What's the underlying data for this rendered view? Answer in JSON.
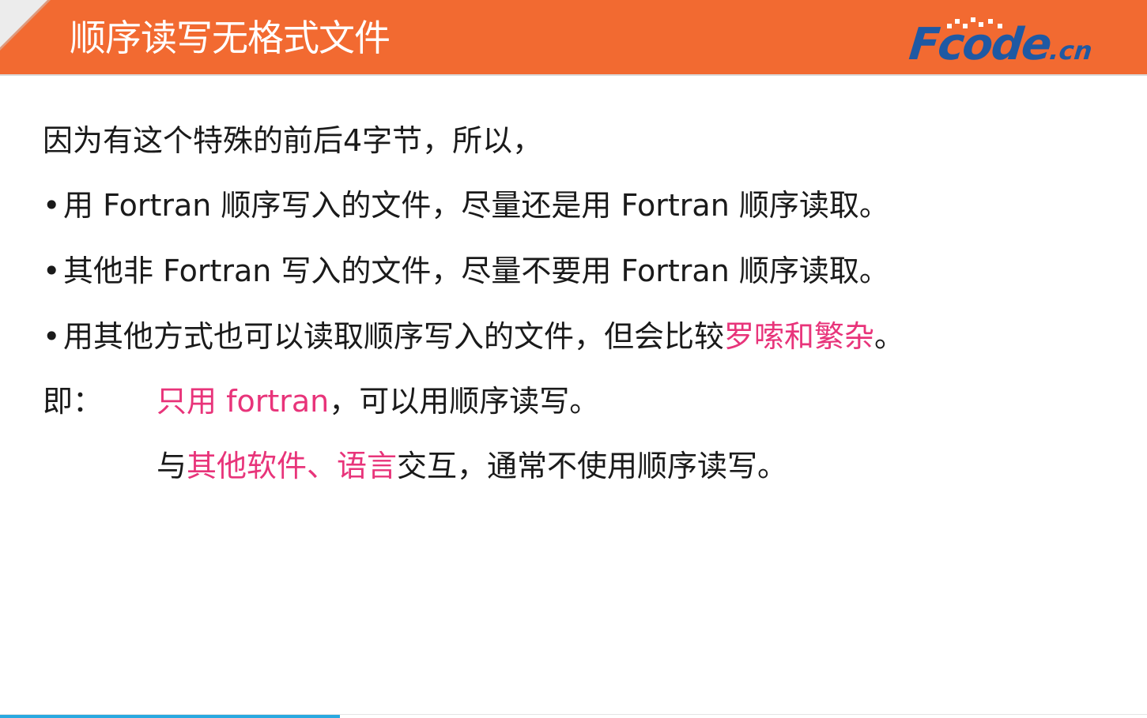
{
  "header": {
    "title": "顺序读写无格式文件",
    "logo_main": "Fcode",
    "logo_suffix": ".cn"
  },
  "content": {
    "intro": "因为有这个特殊的前后4字节，所以，",
    "bullets": [
      {
        "bullet": "•",
        "text": "用 Fortran 顺序写入的文件，尽量还是用 Fortran 顺序读取。"
      },
      {
        "bullet": "•",
        "text": "其他非 Fortran 写入的文件，尽量不要用 Fortran 顺序读取。"
      },
      {
        "bullet": "•",
        "text_before": "用其他方式也可以读取顺序写入的文件，但会比较",
        "highlight": "罗嗦和繁杂",
        "text_after": "。"
      }
    ],
    "summary": {
      "label": "即：",
      "line1_highlight": "只用 fortran",
      "line1_rest": "，可以用顺序读写。",
      "line2_start": "与",
      "line2_highlight": "其他软件、语言",
      "line2_rest": "交互，通常不使用顺序读写。"
    }
  },
  "colors": {
    "header_bg": "#f26a31",
    "highlight": "#e8347a",
    "logo": "#1f59a3",
    "progress": "#29a9e0"
  }
}
